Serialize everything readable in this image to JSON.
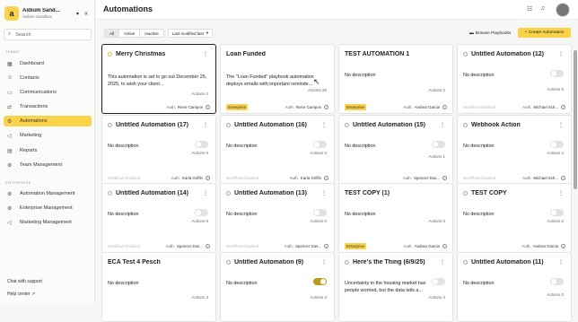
{
  "app": {
    "workspace_name": "Aidium Sand...",
    "workspace_sub": "Aidium Sandbox",
    "logo_letter": "a"
  },
  "sidebar": {
    "search_placeholder": "Search",
    "section_teams": "TEAMS",
    "section_enterprise": "ENTERPRISE",
    "items": [
      {
        "label": "Dashboard"
      },
      {
        "label": "Contacts"
      },
      {
        "label": "Communications"
      },
      {
        "label": "Transactions"
      },
      {
        "label": "Automations"
      },
      {
        "label": "Marketing"
      },
      {
        "label": "Reports"
      },
      {
        "label": "Team Management"
      }
    ],
    "enterprise_items": [
      {
        "label": "Automation Management"
      },
      {
        "label": "Enterprise Management"
      },
      {
        "label": "Marketing Management"
      }
    ],
    "chat": "Chat with support",
    "help": "Help center"
  },
  "header": {
    "title": "Automations"
  },
  "filters": {
    "all": "All",
    "active": "Active",
    "inactive": "Inactive",
    "sort": "Last modified last"
  },
  "actions": {
    "browse": "Browse Playbooks",
    "create": "+ Create Automation"
  },
  "cards": [
    {
      "title": "Merry Christmas",
      "desc": "This automation is set to go out December 25, 2025, to wish your client...",
      "actions": "Actions 2",
      "author": "Rene Campos"
    },
    {
      "title": "Loan Funded",
      "desc": "The \"Loan Funded\" playbook automation deploys emails with important reminde...",
      "actions": "Actions 26",
      "badge": "Enterprise",
      "author": "Rene Campos"
    },
    {
      "title": "TEST AUTOMATION 1",
      "desc": "No description",
      "actions": "Actions 2",
      "badge": "Enterprise",
      "author": "Andrea Garcia"
    },
    {
      "title": "Untitled Automation (12)",
      "desc": "No description",
      "actions": "Actions 5",
      "wd": "Workflow Disabled",
      "author": "Michael Sch..."
    },
    {
      "title": "Untitled Automation (17)",
      "desc": "No description",
      "actions": "Actions 0",
      "wd": "Workflow Disabled",
      "author": "Karla Griffin"
    },
    {
      "title": "Untitled Automation (16)",
      "desc": "No description",
      "actions": "Actions 0",
      "wd": "Workflow Disabled",
      "author": "Karla Griffin"
    },
    {
      "title": "Untitled Automation (15)",
      "desc": "No description",
      "actions": "Actions 1",
      "author": "Spencer Dus..."
    },
    {
      "title": "Webhook Action",
      "desc": "No description",
      "actions": "Actions 2",
      "wd": "Workflow Disabled",
      "author": "Michael Sch..."
    },
    {
      "title": "Untitled Automation (14)",
      "desc": "No description",
      "actions": "Actions 0",
      "wd": "Workflow Disabled",
      "author": "Spencer Dus..."
    },
    {
      "title": "Untitled Automation (13)",
      "desc": "No description",
      "actions": "Actions 0",
      "wd": "Workflow Disabled",
      "author": "Spencer Dus..."
    },
    {
      "title": "TEST COPY (1)",
      "desc": "No description",
      "actions": "Actions 0",
      "badge": "Enterprise",
      "author": "Andrea Garcia"
    },
    {
      "title": "TEST COPY",
      "desc": "No description",
      "actions": "Actions 2",
      "author": "Andrea Garcia"
    },
    {
      "title": "ECA Test 4 Pesch",
      "desc": "No description",
      "actions": "Actions 3"
    },
    {
      "title": "Untitled Automation (9)",
      "desc": "No description",
      "actions": "Actions 2"
    },
    {
      "title": "Here's the Thing (6/9/25)",
      "desc": "Uncertainty in the housing market has people worried, but the data tells a...",
      "actions": "Actions 4"
    },
    {
      "title": "Untitled Automation (11)",
      "desc": "No description",
      "actions": "Actions 0"
    }
  ],
  "auth_prefix": "Auth."
}
